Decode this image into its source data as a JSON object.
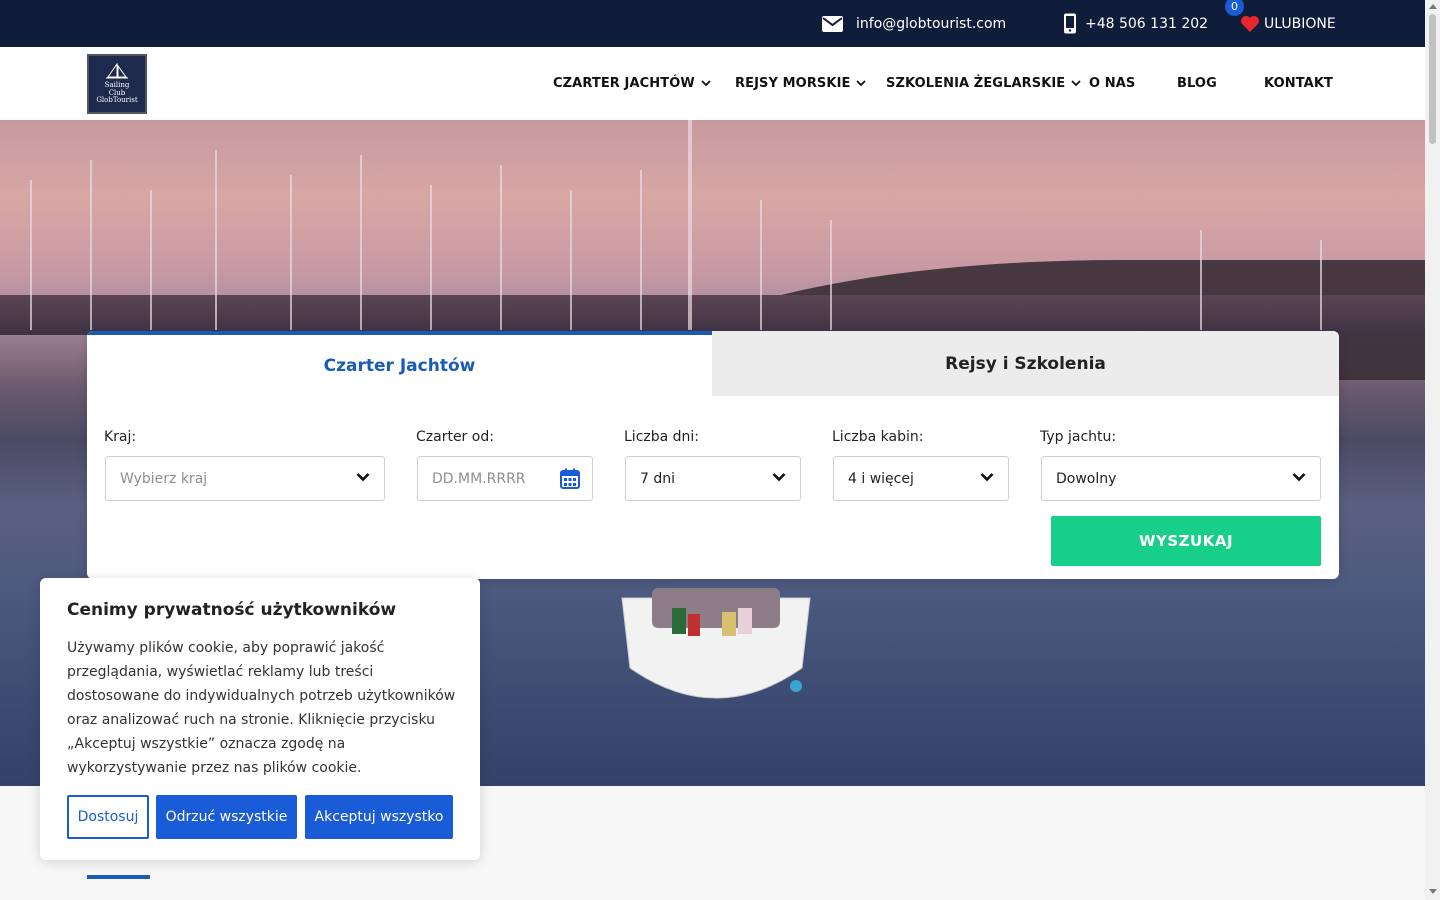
{
  "topbar": {
    "email": "info@globtourist.com",
    "phone": "+48 506 131 202",
    "favorites_count": "0",
    "favorites_label": "ULUBIONE"
  },
  "logo": {
    "line1": "Sailing",
    "line2": "Club",
    "line3": "GlobTourist"
  },
  "nav": {
    "items": [
      {
        "label": "CZARTER JACHTÓW"
      },
      {
        "label": "REJSY MORSKIE"
      },
      {
        "label": "SZKOLENIA ŻEGLARSKIE"
      },
      {
        "label": "O NAS"
      },
      {
        "label": "BLOG"
      },
      {
        "label": "KONTAKT"
      }
    ]
  },
  "search": {
    "tabs": [
      {
        "label": "Czarter Jachtów"
      },
      {
        "label": "Rejsy i Szkolenia"
      }
    ],
    "fields": [
      {
        "label": "Kraj:",
        "placeholder": "Wybierz kraj",
        "value": ""
      },
      {
        "label": "Czarter od:",
        "placeholder": "DD.MM.RRRR",
        "value": ""
      },
      {
        "label": "Liczba dni:",
        "value": "7 dni"
      },
      {
        "label": "Liczba kabin:",
        "value": "4 i więcej"
      },
      {
        "label": "Typ jachtu:",
        "value": "Dowolny"
      }
    ],
    "submit_label": "WYSZUKAJ"
  },
  "cookie": {
    "title": "Cenimy prywatność użytkowników",
    "text": "Używamy plików cookie, aby poprawić jakość przeglądania, wyświetlać reklamy lub treści dostosowane do indywidualnych potrzeb użytkowników oraz analizować ruch na stronie. Kliknięcie przycisku „Akceptuj wszystkie” oznacza zgodę na wykorzystywanie przez nas plików cookie.",
    "customize_label": "Dostosuj",
    "reject_label": "Odrzuć wszystkie",
    "accept_label": "Akceptuj wszystko"
  },
  "colors": {
    "topbar_bg": "#0f1d3b",
    "primary_blue": "#1a5bd8",
    "search_green": "#18cf8a",
    "favorite_red": "#e8262d"
  }
}
